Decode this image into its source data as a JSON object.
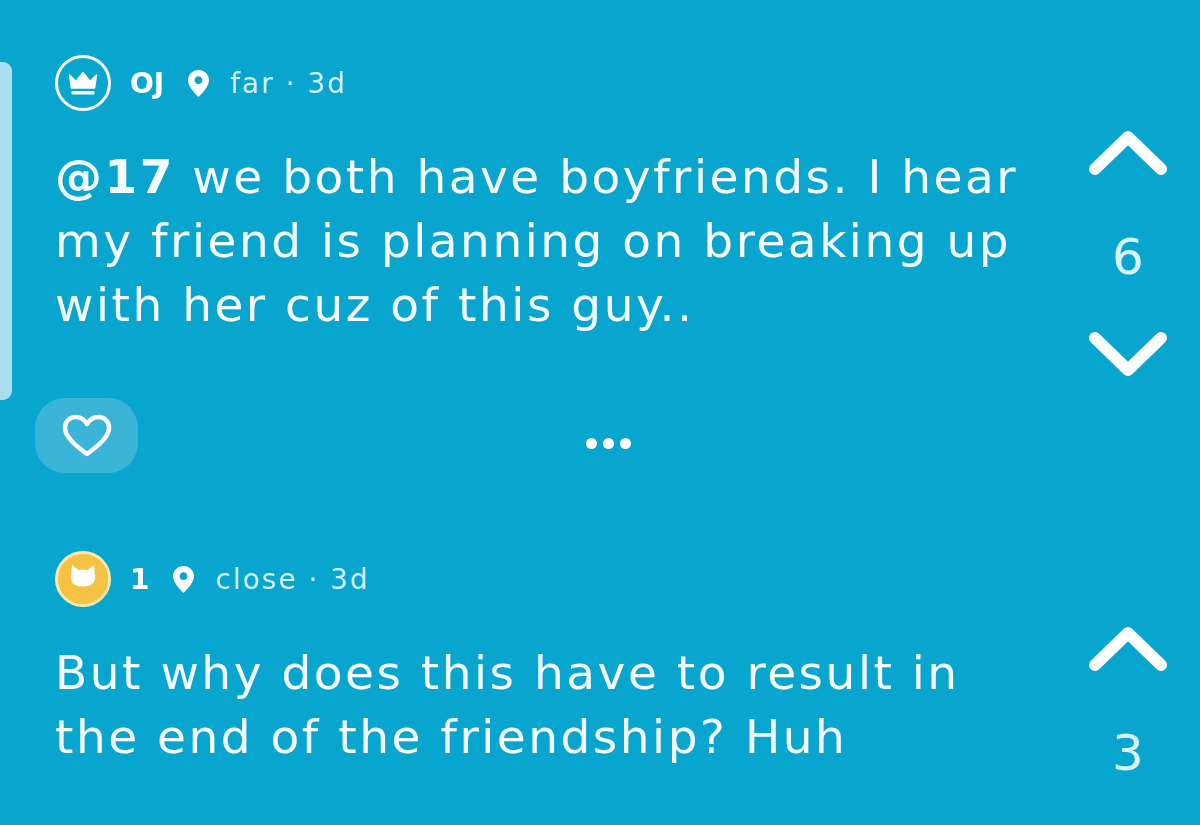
{
  "posts": [
    {
      "highlighted": true,
      "avatar": {
        "kind": "crown"
      },
      "author": "OJ",
      "meta": "far · 3d",
      "body": "**@17** we both have boyfriends. I hear my friend is planning on breaking up with her cuz of this guy..",
      "votes": {
        "arrows": [
          {
            "kind": "up"
          },
          {
            "kind": "down"
          }
        ],
        "count": "6"
      },
      "actions": [
        {
          "kind": "like"
        },
        {
          "kind": "more"
        }
      ]
    },
    {
      "highlighted": false,
      "avatar": {
        "kind": "cat"
      },
      "author": "1",
      "meta": "close · 3d",
      "body": "But why does this have to result in the end of the friendship? Huh",
      "votes": {
        "arrows": [
          {
            "kind": "up"
          }
        ],
        "count": "3"
      }
    }
  ]
}
